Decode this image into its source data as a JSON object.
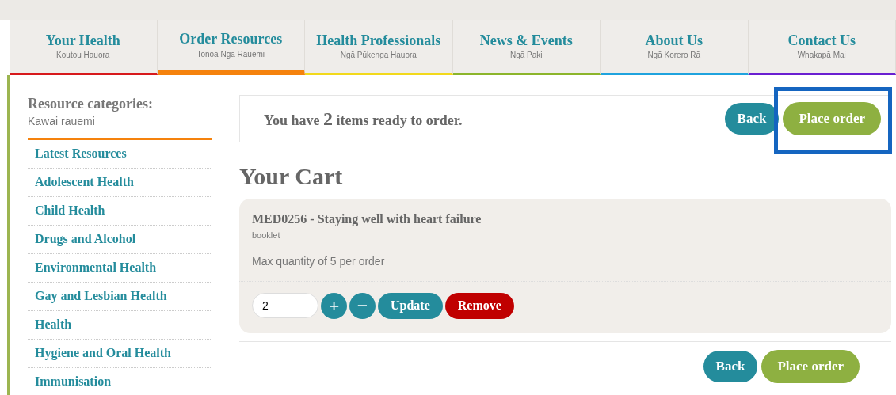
{
  "nav": [
    {
      "label": "Your Health",
      "sub": "Koutou Hauora",
      "color": "#d7191c",
      "selected": false
    },
    {
      "label": "Order Resources",
      "sub": "Tonoa Ngā Rauemi",
      "color": "#f5820d",
      "selected": true
    },
    {
      "label": "Health Professionals",
      "sub": "Ngā Pūkenga Hauora",
      "color": "#f2d91c",
      "selected": false
    },
    {
      "label": "News & Events",
      "sub": "Ngā Paki",
      "color": "#8cb52b",
      "selected": false
    },
    {
      "label": "About Us",
      "sub": "Ngā Korero Rā",
      "color": "#1fa3de",
      "selected": false
    },
    {
      "label": "Contact Us",
      "sub": "Whakapā Mai",
      "color": "#6a1fd1",
      "selected": false
    }
  ],
  "sidebar": {
    "title": "Resource categories:",
    "subtitle": "Kawai rauemi",
    "items": [
      "Latest Resources",
      "Adolescent Health",
      "Child Health",
      "Drugs and Alcohol",
      "Environmental Health",
      "Gay and Lesbian Health",
      "Health",
      "Hygiene and Oral Health",
      "Immunisation"
    ]
  },
  "summary": {
    "text": "You have **2** items ready to order.",
    "back": "Back",
    "place": "Place order"
  },
  "cart": {
    "title": "Your Cart",
    "items": [
      {
        "title": "MED0256 - Staying well with heart failure",
        "type": "booklet",
        "note": "Max quantity of 5 per order",
        "quantity": "2",
        "plus": "+",
        "minus": "−",
        "update": "Update",
        "remove": "Remove"
      }
    ]
  },
  "footer": {
    "back": "Back",
    "place": "Place order"
  }
}
